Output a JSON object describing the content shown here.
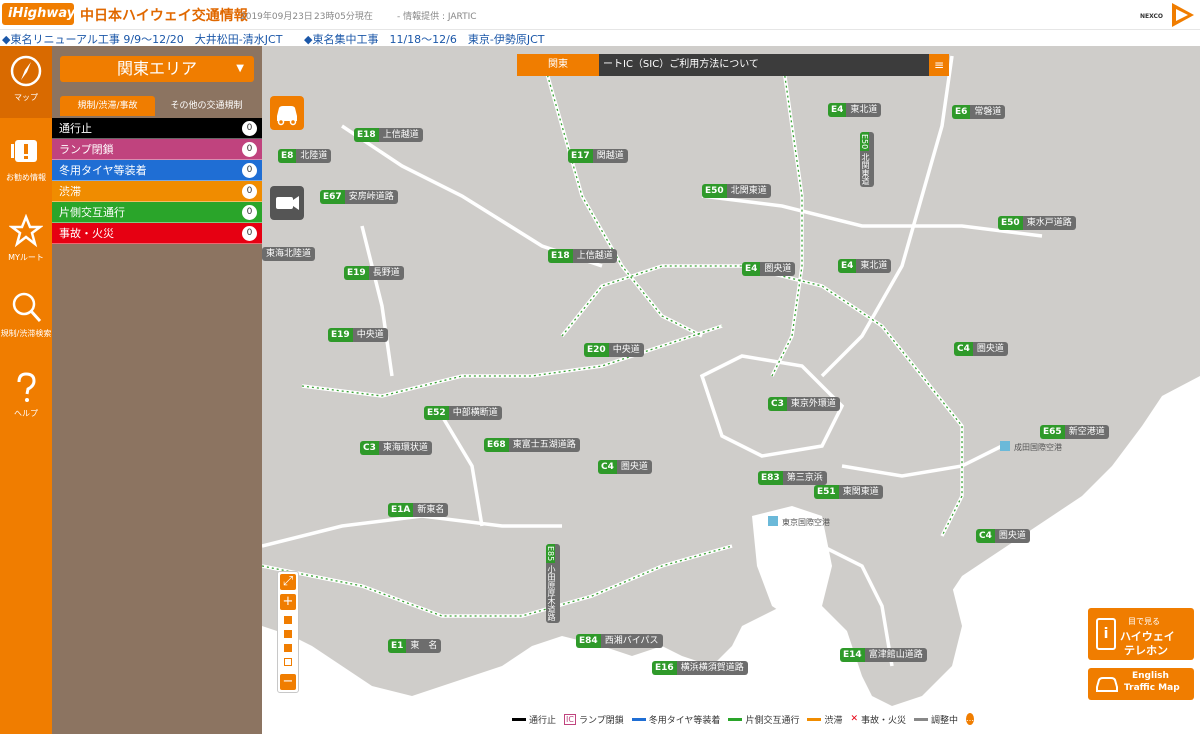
{
  "header": {
    "logo": "iHighway",
    "title": "中日本ハイウェイ交通情報",
    "date": "2019年09月23日",
    "time": "23時05分現在",
    "provider": "- 情報提供 : JARTIC",
    "brand": "NEXCO"
  },
  "ticker": [
    "◆東名リニューアル工事 9/9～12/20　大井松田-清水JCT",
    "◆東名集中工事　11/18～12/6　東京-伊勢原JCT"
  ],
  "nav": [
    {
      "label": "マップ",
      "icon": "compass-icon"
    },
    {
      "label": "お勧め情報",
      "icon": "recommend-icon"
    },
    {
      "label": "MYルート",
      "icon": "star-icon"
    },
    {
      "label": "規制/渋滞検索",
      "icon": "search-icon"
    },
    {
      "label": "ヘルプ",
      "icon": "help-icon"
    }
  ],
  "panel": {
    "area": "関東エリア",
    "tabs": [
      "規制/渋滞/事故",
      "その他の交通規制"
    ],
    "legend": [
      {
        "label": "通行止",
        "count": "0",
        "color": "#000000"
      },
      {
        "label": "ランプ閉鎖",
        "count": "0",
        "color": "#c0437e"
      },
      {
        "label": "冬用タイヤ等装着",
        "count": "0",
        "color": "#1f6ed4"
      },
      {
        "label": "渋滞",
        "count": "0",
        "color": "#f08c00"
      },
      {
        "label": "片側交互通行",
        "count": "0",
        "color": "#2aa52a"
      },
      {
        "label": "事故・火災",
        "count": "0",
        "color": "#e60012"
      }
    ]
  },
  "map": {
    "region": "関東",
    "message": "ートIC（SIC）ご利用方法について",
    "menu": "≡",
    "roads": [
      {
        "num": "E18",
        "name": "上信越道"
      },
      {
        "num": "E17",
        "name": "関越道"
      },
      {
        "num": "E4",
        "name": "東北道"
      },
      {
        "num": "E6",
        "name": "常磐道"
      },
      {
        "num": "E8",
        "name": "北陸道"
      },
      {
        "num": "E67",
        "name": "安房峠道路"
      },
      {
        "num": "E50",
        "name": "北関東道"
      },
      {
        "num": "E50",
        "name": "東水戸道路"
      },
      {
        "num": "E18",
        "name": "上信越道"
      },
      {
        "num": "E4",
        "name": "圏央道"
      },
      {
        "num": "E4",
        "name": "東北道"
      },
      {
        "num": "E19",
        "name": "長野道"
      },
      {
        "num": "E19",
        "name": "中央道"
      },
      {
        "num": "E20",
        "name": "中央道"
      },
      {
        "num": "C4",
        "name": "圏央道"
      },
      {
        "num": "E52",
        "name": "中部横断道"
      },
      {
        "num": "C3",
        "name": "東京外環道"
      },
      {
        "num": "E65",
        "name": "新空港道"
      },
      {
        "num": "C3",
        "name": "東海環状道"
      },
      {
        "num": "E68",
        "name": "東富士五湖道路"
      },
      {
        "num": "C4",
        "name": "圏央道"
      },
      {
        "num": "E83",
        "name": "第三京浜"
      },
      {
        "num": "E51",
        "name": "東関東道"
      },
      {
        "num": "E1A",
        "name": "新東名"
      },
      {
        "num": "C4",
        "name": "圏央道"
      },
      {
        "num": "E84",
        "name": "西湘バイパス"
      },
      {
        "num": "E1",
        "name": "東　名"
      },
      {
        "num": "E16",
        "name": "横浜横須賀道路"
      },
      {
        "num": "E14",
        "name": "富津館山道路"
      },
      {
        "num": "",
        "name": "東海北陸道"
      }
    ],
    "vertical_roads": [
      {
        "num": "E50",
        "name": "北関東道"
      },
      {
        "num": "E85",
        "name": "小田原厚木道路"
      }
    ],
    "places": [
      "成田国際空港",
      "東京国際空港"
    ],
    "telephone": {
      "line1": "目で見る",
      "line2": "ハイウェイ",
      "line3": "テレホン"
    },
    "english": {
      "line1": "English",
      "line2": "Traffic Map"
    },
    "zoom_in": "+",
    "zoom_out": "−",
    "legend": [
      {
        "label": "通行止",
        "color": "#000000"
      },
      {
        "label": "ランプ閉鎖",
        "color": "#c0437e"
      },
      {
        "label": "冬用タイヤ等装着",
        "color": "#1f6ed4"
      },
      {
        "label": "片側交互通行",
        "color": "#2aa52a"
      },
      {
        "label": "渋滞",
        "color": "#f08c00"
      },
      {
        "label": "事故・火災",
        "color": "#e60012"
      },
      {
        "label": "調整中",
        "color": "#888888"
      }
    ],
    "ramp_mark": "IC",
    "accident_mark": "✕"
  }
}
